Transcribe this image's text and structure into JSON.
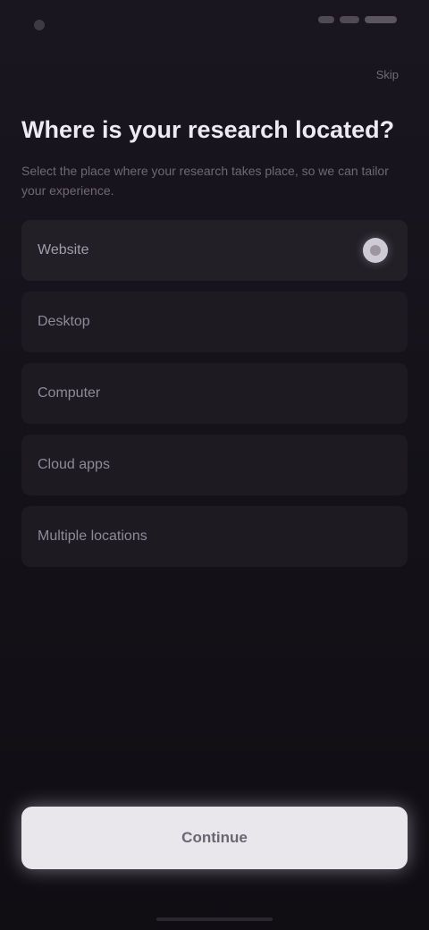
{
  "status_bar": {
    "time": ""
  },
  "header": {
    "skip_label": "Skip"
  },
  "main": {
    "title": "Where is your research located?",
    "subtitle": "Select the place where your research takes place, so we can tailor your experience.",
    "options": [
      {
        "label": "Website",
        "selected": true
      },
      {
        "label": "Desktop",
        "selected": false
      },
      {
        "label": "Computer",
        "selected": false
      },
      {
        "label": "Cloud apps",
        "selected": false
      },
      {
        "label": "Multiple locations",
        "selected": false
      }
    ]
  },
  "footer": {
    "continue_label": "Continue"
  }
}
